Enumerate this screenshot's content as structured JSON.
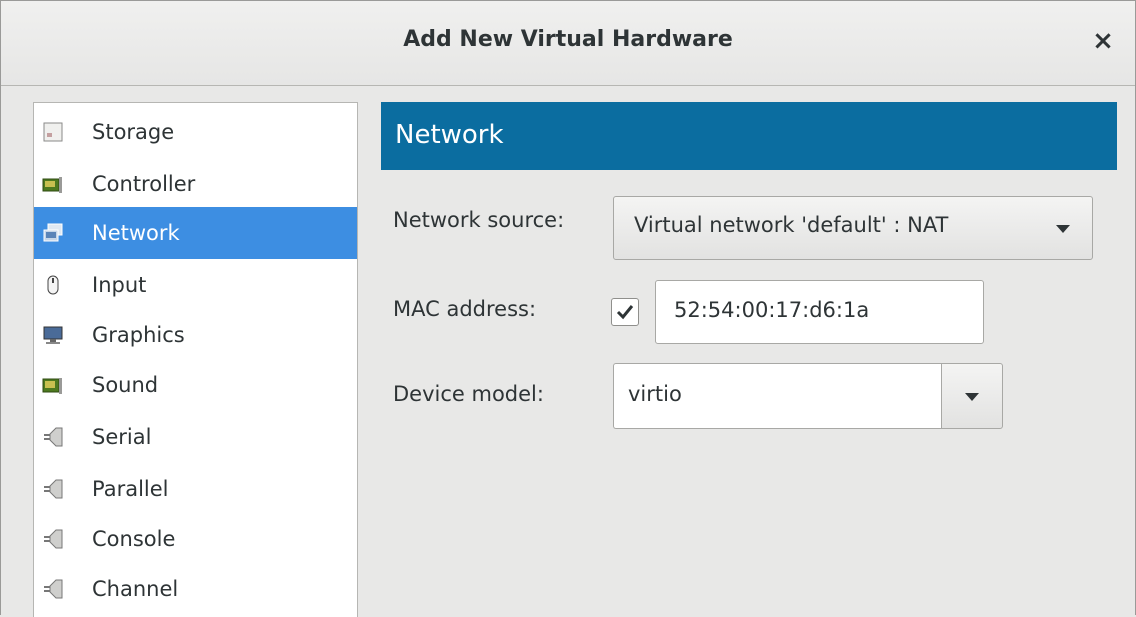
{
  "window": {
    "title": "Add New Virtual Hardware",
    "close_glyph": "×"
  },
  "sidebar": {
    "items": [
      {
        "label": "Storage",
        "icon": "storage-icon"
      },
      {
        "label": "Controller",
        "icon": "controller-icon"
      },
      {
        "label": "Network",
        "icon": "network-icon",
        "selected": true
      },
      {
        "label": "Input",
        "icon": "mouse-icon"
      },
      {
        "label": "Graphics",
        "icon": "monitor-icon"
      },
      {
        "label": "Sound",
        "icon": "sound-card-icon"
      },
      {
        "label": "Serial",
        "icon": "port-icon"
      },
      {
        "label": "Parallel",
        "icon": "port-icon"
      },
      {
        "label": "Console",
        "icon": "port-icon"
      },
      {
        "label": "Channel",
        "icon": "port-icon"
      }
    ]
  },
  "main": {
    "header": "Network",
    "network_source": {
      "label": "Network source:",
      "value": "Virtual network 'default' : NAT"
    },
    "mac": {
      "label": "MAC address:",
      "checked": true,
      "value": "52:54:00:17:d6:1a"
    },
    "device_model": {
      "label": "Device model:",
      "value": "virtio"
    }
  },
  "colors": {
    "header_band": "#0b6da0",
    "selection": "#3d8ee2"
  }
}
